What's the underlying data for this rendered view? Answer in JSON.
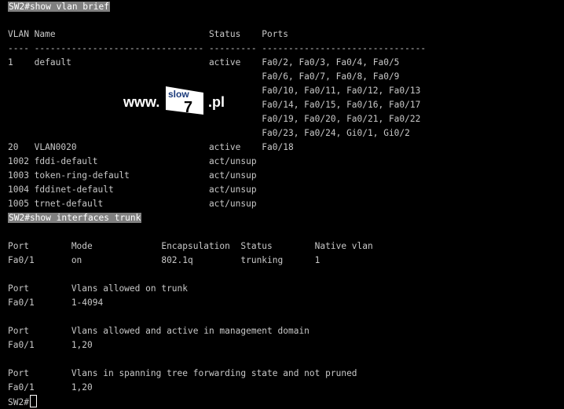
{
  "cmd1": "SW2#show vlan brief",
  "vlan_header": "VLAN Name                             Status    Ports",
  "vlan_sep": "---- -------------------------------- --------- -------------------------------",
  "vlan_rows": [
    "1    default                          active    Fa0/2, Fa0/3, Fa0/4, Fa0/5",
    "                                                Fa0/6, Fa0/7, Fa0/8, Fa0/9",
    "                                                Fa0/10, Fa0/11, Fa0/12, Fa0/13",
    "                                                Fa0/14, Fa0/15, Fa0/16, Fa0/17",
    "                                                Fa0/19, Fa0/20, Fa0/21, Fa0/22",
    "                                                Fa0/23, Fa0/24, Gi0/1, Gi0/2",
    "20   VLAN0020                         active    Fa0/18",
    "1002 fddi-default                     act/unsup",
    "1003 token-ring-default               act/unsup",
    "1004 fddinet-default                  act/unsup",
    "1005 trnet-default                    act/unsup"
  ],
  "cmd2": "SW2#show interfaces trunk",
  "trunk_lines": [
    "",
    "Port        Mode             Encapsulation  Status        Native vlan",
    "Fa0/1       on               802.1q         trunking      1",
    "",
    "Port        Vlans allowed on trunk",
    "Fa0/1       1-4094",
    "",
    "Port        Vlans allowed and active in management domain",
    "Fa0/1       1,20",
    "",
    "Port        Vlans in spanning tree forwarding state and not pruned",
    "Fa0/1       1,20"
  ],
  "prompt": "SW2#",
  "watermark": {
    "www": "www.",
    "slow": "slow",
    "seven": "7",
    "pl": ".pl"
  },
  "colors": {
    "background": "#000000",
    "text": "#c8c8c8",
    "highlight": "#808080"
  }
}
